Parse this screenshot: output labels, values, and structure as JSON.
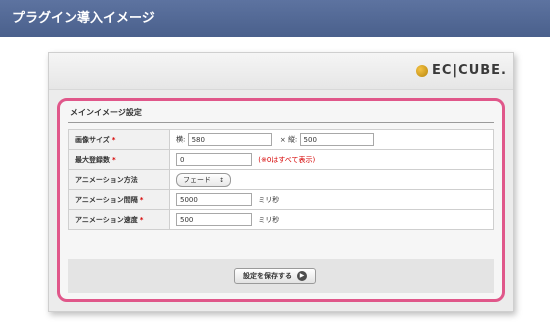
{
  "banner": {
    "title": "プラグイン導入イメージ"
  },
  "brand": {
    "logo_text": "EC|CUBE."
  },
  "section": {
    "title": "メインイメージ設定"
  },
  "form": {
    "image_size": {
      "label": "画像サイズ",
      "width_label": "横:",
      "width_value": "580",
      "separator": "×",
      "height_label": "縦:",
      "height_value": "500"
    },
    "max_count": {
      "label": "最大登録数",
      "value": "0",
      "note": "(※0はすべて表示)"
    },
    "animation_method": {
      "label": "アニメーション方法",
      "selected": "フェード",
      "arrows": "↕"
    },
    "animation_interval": {
      "label": "アニメーション間隔",
      "value": "5000",
      "unit": "ミリ秒"
    },
    "animation_speed": {
      "label": "アニメーション速度",
      "value": "500",
      "unit": "ミリ秒"
    },
    "required_mark": "*"
  },
  "actions": {
    "save_label": "設定を保存する",
    "save_icon": "arrow-right-circle-icon"
  },
  "colors": {
    "banner": "#5369a0",
    "highlight": "#e0578a",
    "required": "#d60000"
  }
}
